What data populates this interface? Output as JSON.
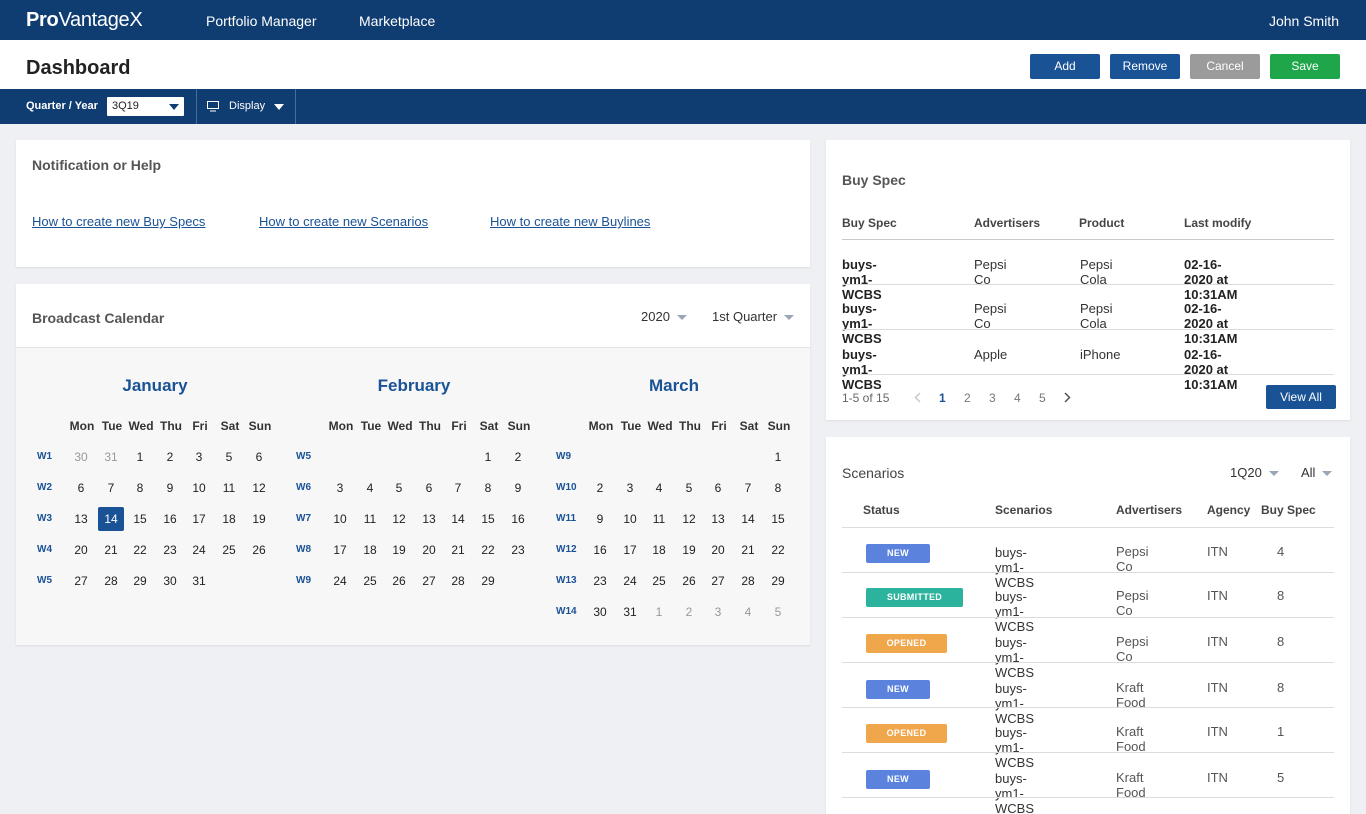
{
  "topnav": {
    "logo_pro": "Pro",
    "logo_rest": "VantageX",
    "links": [
      "Portfolio Manager",
      "Marketplace"
    ],
    "user": "John Smith"
  },
  "pagebar": {
    "title": "Dashboard",
    "buttons": [
      {
        "label": "Add",
        "color": "#1a5296"
      },
      {
        "label": "Remove",
        "color": "#1a5296"
      },
      {
        "label": "Cancel",
        "color": "#9b9b9b"
      },
      {
        "label": "Save",
        "color": "#1fa64a"
      }
    ]
  },
  "toolbar": {
    "quarter_label": "Quarter / Year",
    "quarter_value": "3Q19",
    "display_label": "Display"
  },
  "notification": {
    "title": "Notification or Help",
    "links": [
      "How to create new Buy Specs",
      "How to create new Scenarios",
      "How to create new Buylines"
    ]
  },
  "calendar": {
    "title": "Broadcast Calendar",
    "year": "2020",
    "quarter": "1st Quarter",
    "weekdays": [
      "Mon",
      "Tue",
      "Wed",
      "Thu",
      "Fri",
      "Sat",
      "Sun"
    ],
    "months": [
      {
        "name": "January",
        "weeks": [
          {
            "label": "W1",
            "days": [
              {
                "d": "30",
                "o": true
              },
              {
                "d": "31",
                "o": true
              },
              {
                "d": "1"
              },
              {
                "d": "2"
              },
              {
                "d": "3"
              },
              {
                "d": "5"
              },
              {
                "d": "6"
              }
            ]
          },
          {
            "label": "W2",
            "days": [
              {
                "d": "6"
              },
              {
                "d": "7"
              },
              {
                "d": "8"
              },
              {
                "d": "9"
              },
              {
                "d": "10"
              },
              {
                "d": "11"
              },
              {
                "d": "12"
              }
            ]
          },
          {
            "label": "W3",
            "days": [
              {
                "d": "13"
              },
              {
                "d": "14",
                "s": true
              },
              {
                "d": "15"
              },
              {
                "d": "16"
              },
              {
                "d": "17"
              },
              {
                "d": "18"
              },
              {
                "d": "19"
              }
            ]
          },
          {
            "label": "W4",
            "days": [
              {
                "d": "20"
              },
              {
                "d": "21"
              },
              {
                "d": "22"
              },
              {
                "d": "23"
              },
              {
                "d": "24"
              },
              {
                "d": "25"
              },
              {
                "d": "26"
              }
            ]
          },
          {
            "label": "W5",
            "days": [
              {
                "d": "27"
              },
              {
                "d": "28"
              },
              {
                "d": "29"
              },
              {
                "d": "30"
              },
              {
                "d": "31"
              },
              {
                "d": ""
              },
              {
                "d": ""
              }
            ]
          }
        ]
      },
      {
        "name": "February",
        "weeks": [
          {
            "label": "W5",
            "days": [
              {
                "d": ""
              },
              {
                "d": ""
              },
              {
                "d": ""
              },
              {
                "d": ""
              },
              {
                "d": ""
              },
              {
                "d": "1"
              },
              {
                "d": "2"
              }
            ]
          },
          {
            "label": "W6",
            "days": [
              {
                "d": "3"
              },
              {
                "d": "4"
              },
              {
                "d": "5"
              },
              {
                "d": "6"
              },
              {
                "d": "7"
              },
              {
                "d": "8"
              },
              {
                "d": "9"
              }
            ]
          },
          {
            "label": "W7",
            "days": [
              {
                "d": "10"
              },
              {
                "d": "11"
              },
              {
                "d": "12"
              },
              {
                "d": "13"
              },
              {
                "d": "14"
              },
              {
                "d": "15"
              },
              {
                "d": "16"
              }
            ]
          },
          {
            "label": "W8",
            "days": [
              {
                "d": "17"
              },
              {
                "d": "18"
              },
              {
                "d": "19"
              },
              {
                "d": "20"
              },
              {
                "d": "21"
              },
              {
                "d": "22"
              },
              {
                "d": "23"
              }
            ]
          },
          {
            "label": "W9",
            "days": [
              {
                "d": "24"
              },
              {
                "d": "25"
              },
              {
                "d": "26"
              },
              {
                "d": "27"
              },
              {
                "d": "28"
              },
              {
                "d": "29"
              },
              {
                "d": ""
              }
            ]
          }
        ]
      },
      {
        "name": "March",
        "weeks": [
          {
            "label": "W9",
            "days": [
              {
                "d": ""
              },
              {
                "d": ""
              },
              {
                "d": ""
              },
              {
                "d": ""
              },
              {
                "d": ""
              },
              {
                "d": ""
              },
              {
                "d": "1"
              }
            ]
          },
          {
            "label": "W10",
            "days": [
              {
                "d": "2"
              },
              {
                "d": "3"
              },
              {
                "d": "4"
              },
              {
                "d": "5"
              },
              {
                "d": "6"
              },
              {
                "d": "7"
              },
              {
                "d": "8"
              }
            ]
          },
          {
            "label": "W11",
            "days": [
              {
                "d": "9"
              },
              {
                "d": "10"
              },
              {
                "d": "11"
              },
              {
                "d": "12"
              },
              {
                "d": "13"
              },
              {
                "d": "14"
              },
              {
                "d": "15"
              }
            ]
          },
          {
            "label": "W12",
            "days": [
              {
                "d": "16"
              },
              {
                "d": "17"
              },
              {
                "d": "18"
              },
              {
                "d": "19"
              },
              {
                "d": "20"
              },
              {
                "d": "21"
              },
              {
                "d": "22"
              }
            ]
          },
          {
            "label": "W13",
            "days": [
              {
                "d": "23"
              },
              {
                "d": "24"
              },
              {
                "d": "25"
              },
              {
                "d": "26"
              },
              {
                "d": "27"
              },
              {
                "d": "28"
              },
              {
                "d": "29"
              }
            ]
          },
          {
            "label": "W14",
            "days": [
              {
                "d": "30"
              },
              {
                "d": "31"
              },
              {
                "d": "1",
                "o": true
              },
              {
                "d": "2",
                "o": true
              },
              {
                "d": "3",
                "o": true
              },
              {
                "d": "4",
                "o": true
              },
              {
                "d": "5",
                "o": true
              }
            ]
          }
        ]
      }
    ]
  },
  "buyspec": {
    "title": "Buy Spec",
    "columns": [
      "Buy Spec",
      "Advertisers",
      "Product",
      "Last modify"
    ],
    "rows": [
      [
        "buys-ym1-WCBS",
        "Pepsi Co",
        "Pepsi Cola",
        "02-16-2020 at 10:31AM"
      ],
      [
        "buys-ym1-WCBS",
        "Pepsi Co",
        "Pepsi Cola",
        "02-16-2020 at 10:31AM"
      ],
      [
        "buys-ym1-WCBS",
        "Apple",
        "iPhone",
        "02-16-2020 at 10:31AM"
      ]
    ],
    "range_text": "1-5 of 15",
    "pages": [
      "1",
      "2",
      "3",
      "4",
      "5"
    ],
    "current_page": "1",
    "view_all": "View All"
  },
  "scenarios": {
    "title": "Scenarios",
    "quarter": "1Q20",
    "filter": "All",
    "columns": [
      "Status",
      "Scenarios",
      "Advertisers",
      "Agency",
      "Buy Spec"
    ],
    "rows": [
      {
        "status": "NEW",
        "color": "#5b83dd",
        "scenario": "buys-ym1-WCBS",
        "advertiser": "Pepsi Co",
        "agency": "ITN",
        "buyspec": "4"
      },
      {
        "status": "SUBMITTED",
        "color": "#2cb39d",
        "scenario": "buys-ym1-WCBS",
        "advertiser": "Pepsi Co",
        "agency": "ITN",
        "buyspec": "8"
      },
      {
        "status": "OPENED",
        "color": "#f0a64b",
        "scenario": "buys-ym1-WCBS",
        "advertiser": "Pepsi Co",
        "agency": "ITN",
        "buyspec": "8"
      },
      {
        "status": "NEW",
        "color": "#5b83dd",
        "scenario": "buys-ym1-WCBS",
        "advertiser": "Kraft Food",
        "agency": "ITN",
        "buyspec": "8"
      },
      {
        "status": "OPENED",
        "color": "#f0a64b",
        "scenario": "buys-ym1-WCBS",
        "advertiser": "Kraft Food",
        "agency": "ITN",
        "buyspec": "1"
      },
      {
        "status": "NEW",
        "color": "#5b83dd",
        "scenario": "buys-ym1-WCBS",
        "advertiser": "Kraft Food",
        "agency": "ITN",
        "buyspec": "5"
      }
    ]
  }
}
